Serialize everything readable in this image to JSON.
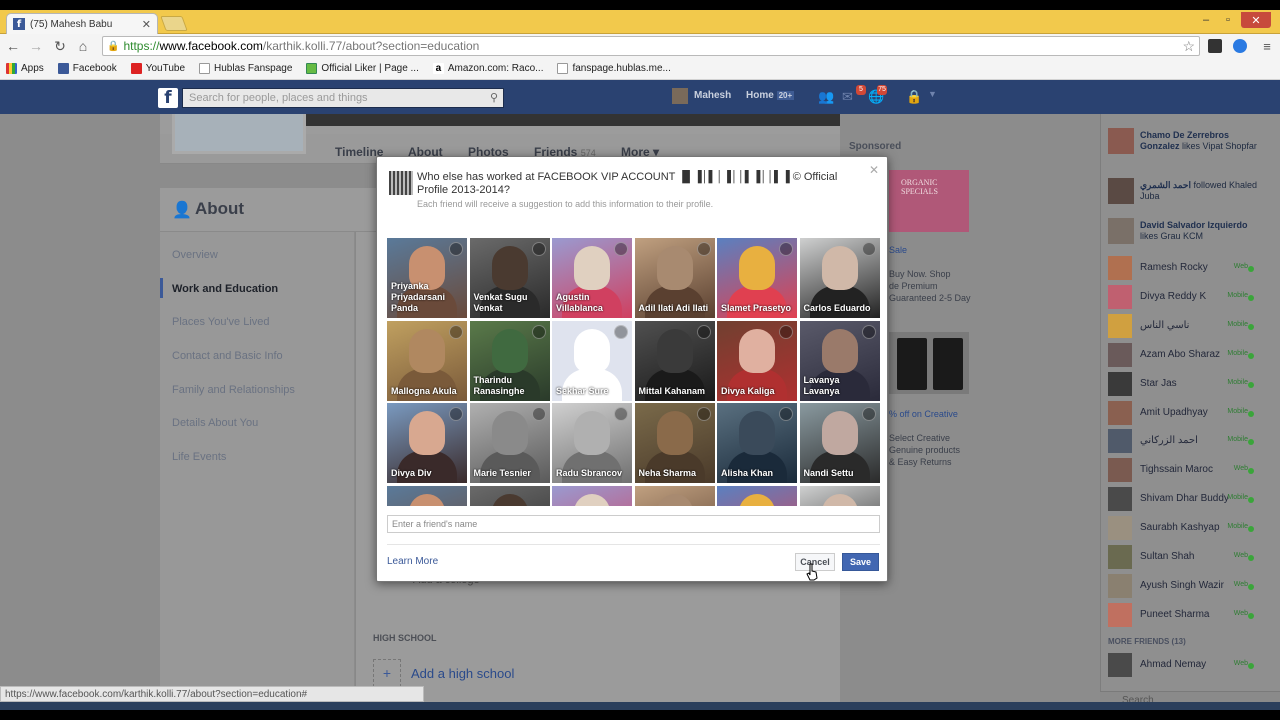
{
  "browser": {
    "tab_title": "(75) Mahesh Babu",
    "tab_icon": "f",
    "url_https": "https://",
    "url_domain": "www.facebook.com",
    "url_path": "/karthik.kolli.77/about?section=education",
    "bookmarks": [
      "Apps",
      "Facebook",
      "YouTube",
      "Hublas Fanspage",
      "Official Liker | Page ...",
      "Amazon.com: Raco...",
      "fanspage.hublas.me..."
    ],
    "status_url": "https://www.facebook.com/karthik.kolli.77/about?section=education#"
  },
  "fb": {
    "logo": "f",
    "search_placeholder": "Search for people, places and things",
    "user_name": "Mahesh",
    "home_label": "Home",
    "home_count": "20+",
    "notif_badge_1": "5",
    "notif_badge_2": "75"
  },
  "profile": {
    "nav": [
      "Timeline",
      "About",
      "Photos",
      "Friends",
      "More ▾"
    ],
    "friends_count": "574",
    "about_title": "About",
    "left_nav": [
      "Overview",
      "Work and Education",
      "Places You've Lived",
      "Contact and Basic Info",
      "Family and Relationships",
      "Details About You",
      "Life Events"
    ],
    "high_school_label": "HIGH SCHOOL",
    "add_high_school": "Add a high school",
    "fragment_text": "Add a college"
  },
  "ads": {
    "sponsored": "Sponsored",
    "ad1_img_text": "ORGANIC\nSPECIALS",
    "ad1_lines": [
      "Buy Now. Shop",
      "de Premium",
      "Guaranteed 2-5 Day"
    ],
    "ad1_sale": "Sale",
    "ad2_link": "% off on Creative",
    "ad2_lines": [
      "Select Creative",
      "Genuine products",
      "& Easy Returns"
    ]
  },
  "ticker": [
    {
      "name": "Chamo De Zerrebros Gonzalez",
      "text": "likes Vipat Shopfar"
    },
    {
      "name": "احمد الشمري",
      "text": "followed Khaled Juba"
    },
    {
      "name": "David Salvador Izquierdo",
      "text": "likes Grau KCM"
    }
  ],
  "chat": {
    "online": [
      {
        "name": "Ramesh Rocky",
        "status": "Web"
      },
      {
        "name": "Divya Reddy K",
        "status": "Mobile"
      },
      {
        "name": "ناسي الناس",
        "status": "Mobile"
      },
      {
        "name": "Azam Abo Sharaz",
        "status": "Mobile"
      },
      {
        "name": "Star Jas",
        "status": "Mobile"
      },
      {
        "name": "Amit Upadhyay",
        "status": "Mobile"
      },
      {
        "name": "احمد الزركاني",
        "status": "Mobile"
      },
      {
        "name": "Tighssain Maroc",
        "status": "Web"
      },
      {
        "name": "Shivam Dhar Buddy",
        "status": "Mobile"
      },
      {
        "name": "Saurabh Kashyap",
        "status": "Mobile"
      },
      {
        "name": "Sultan Shah",
        "status": "Web"
      },
      {
        "name": "Ayush Singh Wazir",
        "status": "Web"
      },
      {
        "name": "Puneet Sharma",
        "status": "Web"
      }
    ],
    "more_friends_label": "MORE FRIENDS (13)",
    "more": [
      {
        "name": "Ahmad Nemay",
        "status": "Web"
      }
    ],
    "search_placeholder": "Search"
  },
  "dialog": {
    "title": "Who else has worked at FACEBOOK VIP ACCOUNT ▐▌▐│▌│▐││▌▐││▌▐ © Official Profile 2013-2014?",
    "subtitle": "Each friend will receive a suggestion to add this information to their profile.",
    "friends": [
      "Priyanka Priyadarsani Panda",
      "Venkat Sugu Venkat",
      "Agustin Villablanca",
      "Adil Ilati Adi Ilati",
      "Slamet Prasetyo",
      "Carlos Eduardo",
      "Mallogna Akula",
      "Tharindu Ranasinghe",
      "Sekhar Sure",
      "Mittal Kahanam",
      "Divya Kaliga",
      "Lavanya Lavanya",
      "Divya Div",
      "Marie Tesnier",
      "Radu Sbrancov",
      "Neha Sharma",
      "Alisha Khan",
      "Nandi Settu",
      "",
      "",
      "",
      "",
      "",
      ""
    ],
    "friend_input_placeholder": "Enter a friend's name",
    "learn_more": "Learn More",
    "cancel": "Cancel",
    "save": "Save"
  },
  "colors": {
    "fb_blue": "#3b5998",
    "save_button": "#4267b2",
    "chrome_tabbar": "#f2c94c",
    "online_dot": "#3aa53a"
  }
}
